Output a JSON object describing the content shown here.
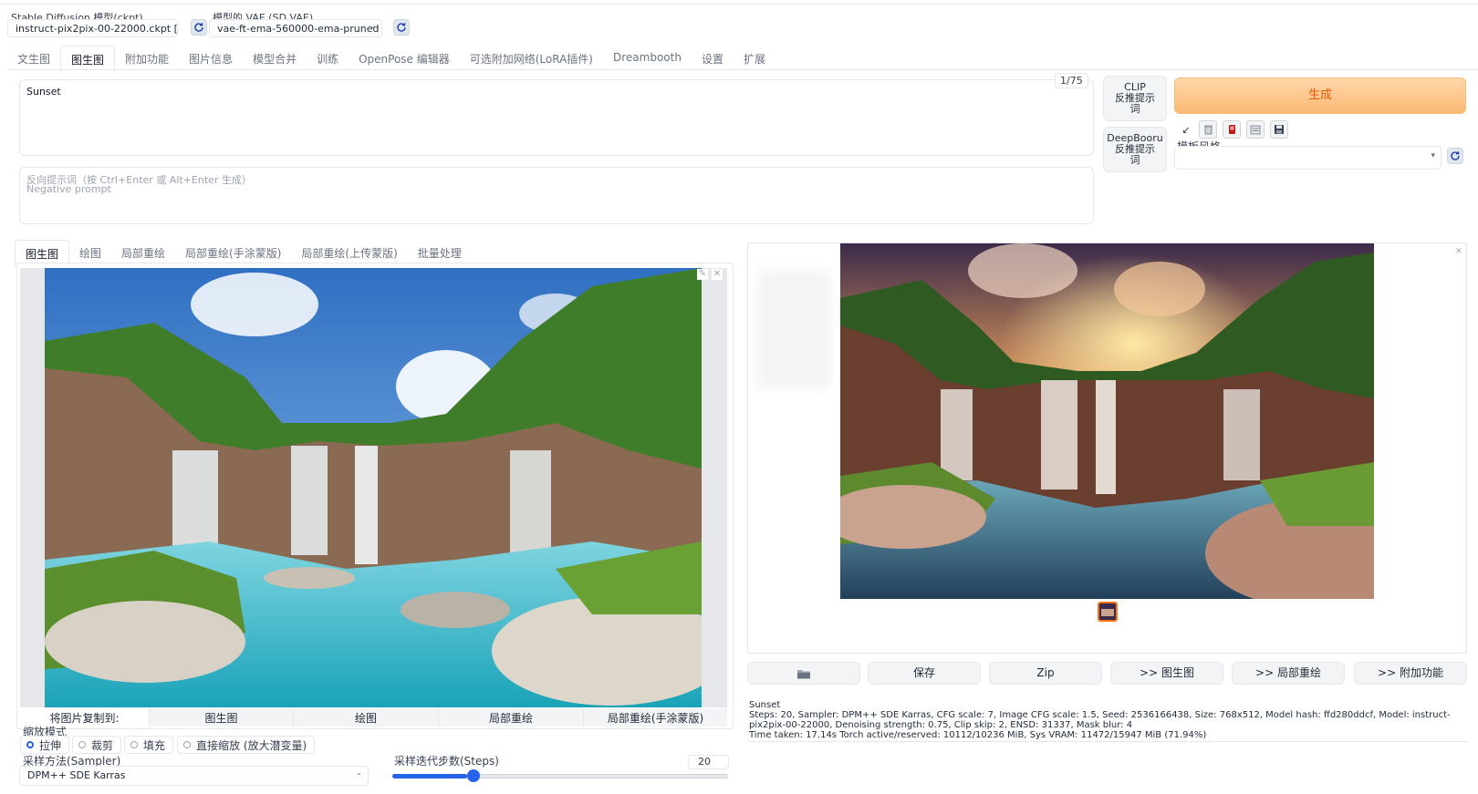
{
  "model": {
    "ckpt_label": "Stable Diffusion 模型(ckpt)",
    "ckpt_value": "instruct-pix2pix-00-22000.ckpt [",
    "vae_label": "模型的 VAE (SD VAE)",
    "vae_value": "vae-ft-ema-560000-ema-pruned"
  },
  "main_tabs": [
    "文生图",
    "图生图",
    "附加功能",
    "图片信息",
    "模型合并",
    "训练",
    "OpenPose 编辑器",
    "可选附加网络(LoRA插件)",
    "Dreambooth",
    "设置",
    "扩展"
  ],
  "prompt": {
    "value": "Sunset",
    "token_count": "1/75",
    "negative_placeholder_line1": "反向提示词（按 Ctrl+Enter 或 Alt+Enter 生成）",
    "negative_placeholder_line2": "Negative prompt"
  },
  "side_buttons": {
    "clip": "CLIP\n反推提示\n词",
    "deepbooru": "DeepBooru\n反推提示\n词",
    "generate": "生成",
    "style_label": "模板风格"
  },
  "sub_tabs": [
    "图生图",
    "绘图",
    "局部重绘",
    "局部重绘(手涂蒙版)",
    "局部重绘(上传蒙版)",
    "批量处理"
  ],
  "copy_to": {
    "label": "将图片复制到:",
    "targets": [
      "图生图",
      "绘图",
      "局部重绘",
      "局部重绘(手涂蒙版)"
    ]
  },
  "resize": {
    "label": "缩放模式",
    "options": [
      "拉伸",
      "裁剪",
      "填充",
      "直接缩放 (放大潜变量)"
    ],
    "selected": "拉伸"
  },
  "sampler": {
    "label": "采样方法(Sampler)",
    "value": "DPM++ SDE Karras"
  },
  "steps": {
    "label": "采样迭代步数(Steps)",
    "value": "20",
    "min": 1,
    "max": 150,
    "current": 20
  },
  "output_buttons": [
    "保存",
    "Zip",
    ">> 图生图",
    ">> 局部重绘",
    ">> 附加功能"
  ],
  "info": {
    "prompt": "Sunset",
    "params": "Steps: 20, Sampler: DPM++ SDE Karras, CFG scale: 7, Image CFG scale: 1.5, Seed: 2536166438, Size: 768x512, Model hash: ffd280ddcf, Model: instruct-pix2pix-00-22000, Denoising strength: 0.75, Clip skip: 2, ENSD: 31337, Mask blur: 4",
    "time": "Time taken: 17.14s  Torch active/reserved: 10112/10236 MiB, Sys VRAM: 11472/15947 MiB (71.94%)"
  },
  "colors": {
    "generate_bg": "#fdba74",
    "generate_text": "#ea580c",
    "slider_accent": "#2563eb"
  }
}
